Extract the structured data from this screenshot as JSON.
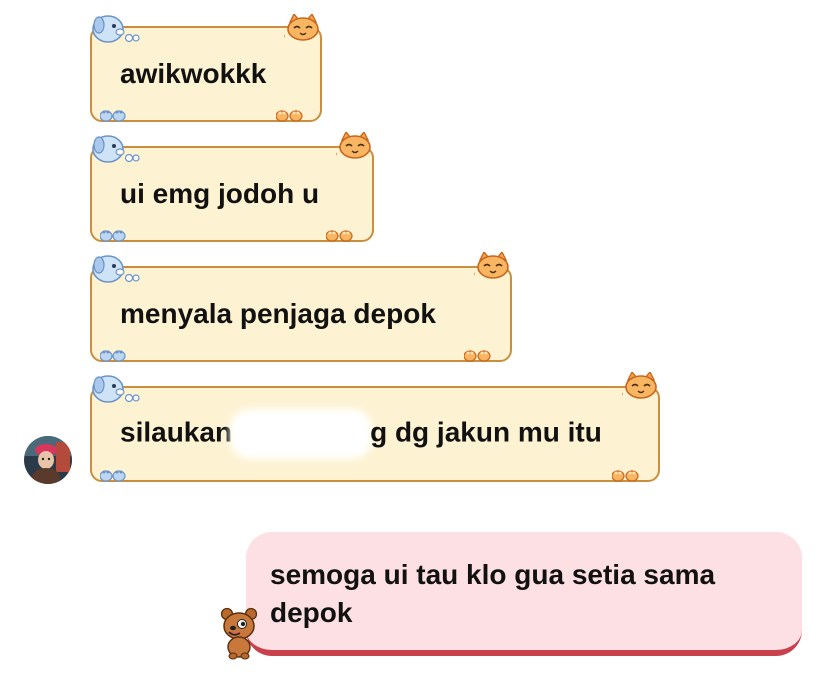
{
  "messages": {
    "received": [
      {
        "text": "awikwokkk"
      },
      {
        "text": "ui emg jodoh u"
      },
      {
        "text": "menyala penjaga depok"
      },
      {
        "text_before": "silaukan",
        "text_after": "g dg jakun mu itu"
      }
    ],
    "sent": {
      "text": "semoga ui tau klo gua setia sama depok"
    }
  },
  "icons": {
    "sender_avatar": "contact-avatar",
    "bubble_decor_top_left": "blue-dog-icon",
    "bubble_decor_top_right": "orange-cat-icon",
    "bubble_decor_bottom_left": "blue-paw-icon",
    "bubble_decor_bottom_right": "orange-paw-icon",
    "sent_decor": "bear-icon"
  },
  "colors": {
    "received_bubble_bg": "#fdf3d3",
    "received_bubble_border": "#c98f3f",
    "sent_bubble_bg": "#fde0e3",
    "sent_bubble_border": "#c9404d"
  }
}
